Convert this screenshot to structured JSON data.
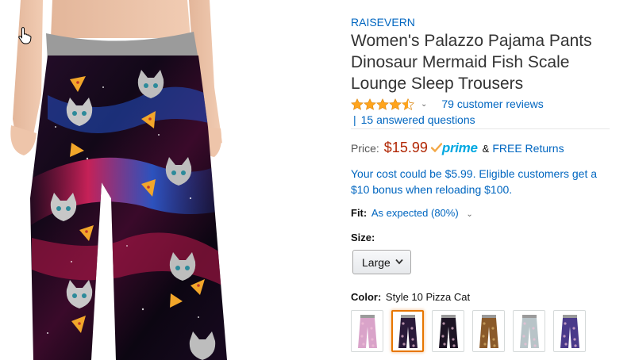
{
  "product": {
    "brand": "RAISEVERN",
    "title": "Women's Palazzo Pajama Pants Dinosaur Mermaid Fish Scale Lounge Sleep Trousers",
    "rating": 4.5,
    "reviews_text": "79 customer reviews",
    "qa_text": "15 answered questions"
  },
  "pricing": {
    "label": "Price:",
    "price": "$15.99",
    "prime_word": "prime",
    "amp": "&",
    "free_returns": "FREE Returns",
    "promo": "Your cost could be $5.99. Eligible customers get a $10 bonus when reloading $100."
  },
  "fit": {
    "label": "Fit:",
    "value": "As expected (80%)"
  },
  "size": {
    "label": "Size:",
    "selected": "Large"
  },
  "color": {
    "label": "Color:",
    "selected": "Style 10 Pizza Cat",
    "swatches": [
      {
        "name": "swatch-1",
        "selected": false,
        "tone": "#d9a3c9"
      },
      {
        "name": "swatch-2",
        "selected": true,
        "tone": "#2a1a3a"
      },
      {
        "name": "swatch-3",
        "selected": false,
        "tone": "#1d1424"
      },
      {
        "name": "swatch-4",
        "selected": false,
        "tone": "#8a5a2a"
      },
      {
        "name": "swatch-5",
        "selected": false,
        "tone": "#b8c4c8"
      },
      {
        "name": "swatch-6",
        "selected": false,
        "tone": "#4a3a8a"
      }
    ]
  },
  "colors": {
    "link": "#0066c0",
    "price": "#b12704",
    "prime": "#00a8e1",
    "star": "#ffa41c",
    "selected_border": "#e77600"
  }
}
